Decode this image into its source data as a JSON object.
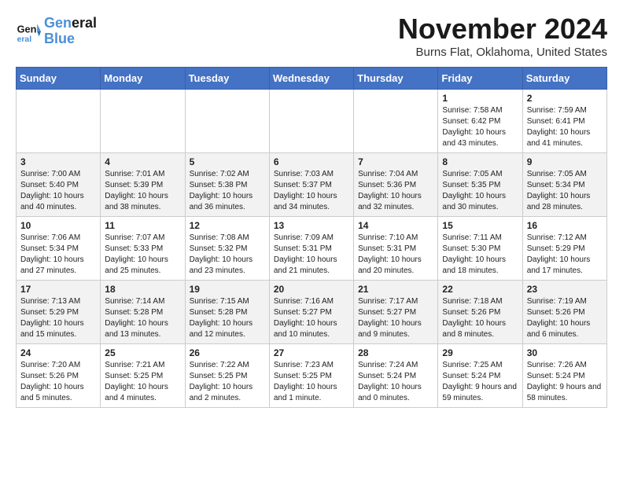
{
  "header": {
    "logo_line1": "General",
    "logo_line2": "Blue",
    "month_title": "November 2024",
    "location": "Burns Flat, Oklahoma, United States"
  },
  "weekdays": [
    "Sunday",
    "Monday",
    "Tuesday",
    "Wednesday",
    "Thursday",
    "Friday",
    "Saturday"
  ],
  "weeks": [
    [
      {
        "day": "",
        "info": ""
      },
      {
        "day": "",
        "info": ""
      },
      {
        "day": "",
        "info": ""
      },
      {
        "day": "",
        "info": ""
      },
      {
        "day": "",
        "info": ""
      },
      {
        "day": "1",
        "info": "Sunrise: 7:58 AM\nSunset: 6:42 PM\nDaylight: 10 hours and 43 minutes."
      },
      {
        "day": "2",
        "info": "Sunrise: 7:59 AM\nSunset: 6:41 PM\nDaylight: 10 hours and 41 minutes."
      }
    ],
    [
      {
        "day": "3",
        "info": "Sunrise: 7:00 AM\nSunset: 5:40 PM\nDaylight: 10 hours and 40 minutes."
      },
      {
        "day": "4",
        "info": "Sunrise: 7:01 AM\nSunset: 5:39 PM\nDaylight: 10 hours and 38 minutes."
      },
      {
        "day": "5",
        "info": "Sunrise: 7:02 AM\nSunset: 5:38 PM\nDaylight: 10 hours and 36 minutes."
      },
      {
        "day": "6",
        "info": "Sunrise: 7:03 AM\nSunset: 5:37 PM\nDaylight: 10 hours and 34 minutes."
      },
      {
        "day": "7",
        "info": "Sunrise: 7:04 AM\nSunset: 5:36 PM\nDaylight: 10 hours and 32 minutes."
      },
      {
        "day": "8",
        "info": "Sunrise: 7:05 AM\nSunset: 5:35 PM\nDaylight: 10 hours and 30 minutes."
      },
      {
        "day": "9",
        "info": "Sunrise: 7:05 AM\nSunset: 5:34 PM\nDaylight: 10 hours and 28 minutes."
      }
    ],
    [
      {
        "day": "10",
        "info": "Sunrise: 7:06 AM\nSunset: 5:34 PM\nDaylight: 10 hours and 27 minutes."
      },
      {
        "day": "11",
        "info": "Sunrise: 7:07 AM\nSunset: 5:33 PM\nDaylight: 10 hours and 25 minutes."
      },
      {
        "day": "12",
        "info": "Sunrise: 7:08 AM\nSunset: 5:32 PM\nDaylight: 10 hours and 23 minutes."
      },
      {
        "day": "13",
        "info": "Sunrise: 7:09 AM\nSunset: 5:31 PM\nDaylight: 10 hours and 21 minutes."
      },
      {
        "day": "14",
        "info": "Sunrise: 7:10 AM\nSunset: 5:31 PM\nDaylight: 10 hours and 20 minutes."
      },
      {
        "day": "15",
        "info": "Sunrise: 7:11 AM\nSunset: 5:30 PM\nDaylight: 10 hours and 18 minutes."
      },
      {
        "day": "16",
        "info": "Sunrise: 7:12 AM\nSunset: 5:29 PM\nDaylight: 10 hours and 17 minutes."
      }
    ],
    [
      {
        "day": "17",
        "info": "Sunrise: 7:13 AM\nSunset: 5:29 PM\nDaylight: 10 hours and 15 minutes."
      },
      {
        "day": "18",
        "info": "Sunrise: 7:14 AM\nSunset: 5:28 PM\nDaylight: 10 hours and 13 minutes."
      },
      {
        "day": "19",
        "info": "Sunrise: 7:15 AM\nSunset: 5:28 PM\nDaylight: 10 hours and 12 minutes."
      },
      {
        "day": "20",
        "info": "Sunrise: 7:16 AM\nSunset: 5:27 PM\nDaylight: 10 hours and 10 minutes."
      },
      {
        "day": "21",
        "info": "Sunrise: 7:17 AM\nSunset: 5:27 PM\nDaylight: 10 hours and 9 minutes."
      },
      {
        "day": "22",
        "info": "Sunrise: 7:18 AM\nSunset: 5:26 PM\nDaylight: 10 hours and 8 minutes."
      },
      {
        "day": "23",
        "info": "Sunrise: 7:19 AM\nSunset: 5:26 PM\nDaylight: 10 hours and 6 minutes."
      }
    ],
    [
      {
        "day": "24",
        "info": "Sunrise: 7:20 AM\nSunset: 5:26 PM\nDaylight: 10 hours and 5 minutes."
      },
      {
        "day": "25",
        "info": "Sunrise: 7:21 AM\nSunset: 5:25 PM\nDaylight: 10 hours and 4 minutes."
      },
      {
        "day": "26",
        "info": "Sunrise: 7:22 AM\nSunset: 5:25 PM\nDaylight: 10 hours and 2 minutes."
      },
      {
        "day": "27",
        "info": "Sunrise: 7:23 AM\nSunset: 5:25 PM\nDaylight: 10 hours and 1 minute."
      },
      {
        "day": "28",
        "info": "Sunrise: 7:24 AM\nSunset: 5:24 PM\nDaylight: 10 hours and 0 minutes."
      },
      {
        "day": "29",
        "info": "Sunrise: 7:25 AM\nSunset: 5:24 PM\nDaylight: 9 hours and 59 minutes."
      },
      {
        "day": "30",
        "info": "Sunrise: 7:26 AM\nSunset: 5:24 PM\nDaylight: 9 hours and 58 minutes."
      }
    ]
  ]
}
